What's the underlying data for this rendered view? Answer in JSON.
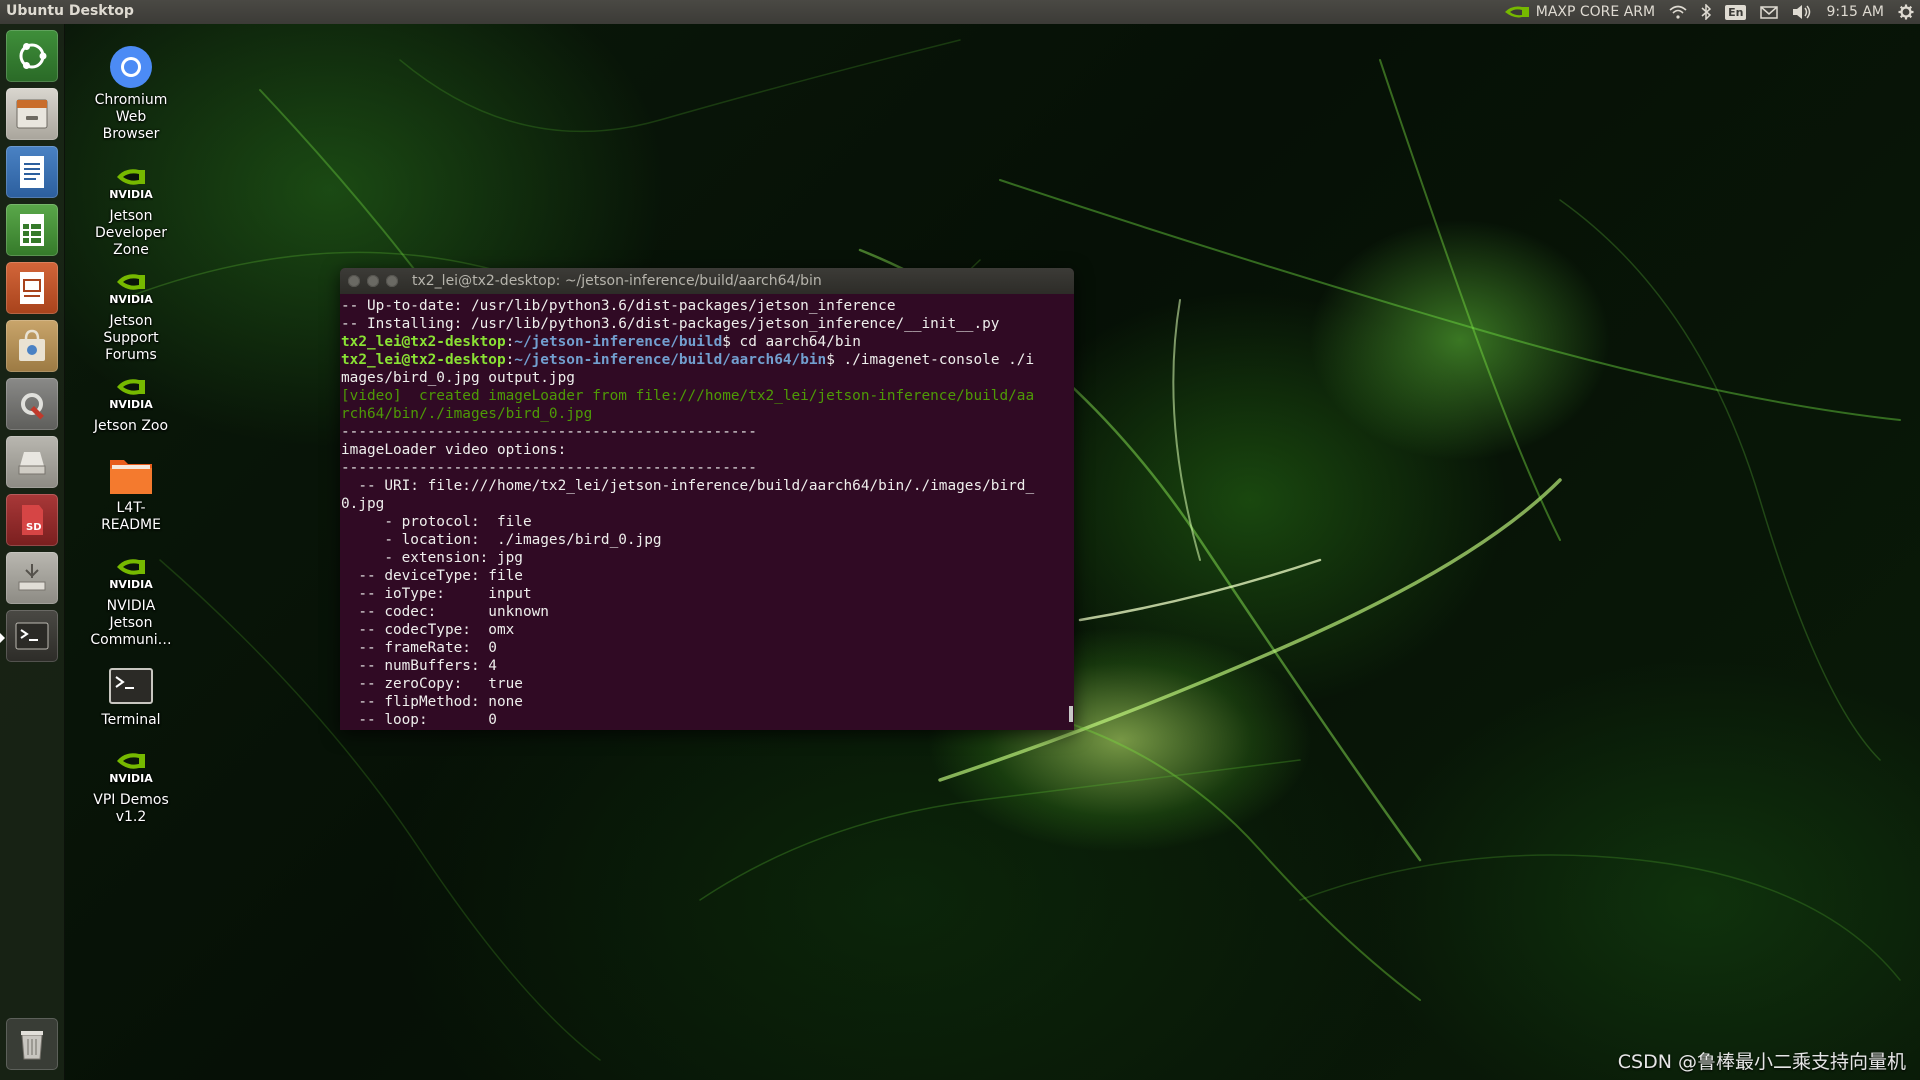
{
  "panel": {
    "title": "Ubuntu Desktop",
    "nvpmodel": "MAXP CORE ARM",
    "keyboard_layout": "En",
    "clock": "9:15 AM",
    "icons": [
      "nvidia-icon",
      "wifi-icon",
      "bluetooth-icon",
      "mail-icon",
      "volume-icon",
      "gear-icon"
    ]
  },
  "launcher": {
    "items": [
      {
        "name": "ubuntu-dash",
        "icon": "ubuntu-logo-icon"
      },
      {
        "name": "files",
        "icon": "file-cabinet-icon"
      },
      {
        "name": "libreoffice-writer",
        "icon": "writer-icon"
      },
      {
        "name": "libreoffice-calc",
        "icon": "calc-icon"
      },
      {
        "name": "libreoffice-impress",
        "icon": "impress-icon"
      },
      {
        "name": "software-center",
        "icon": "shopping-bag-icon"
      },
      {
        "name": "system-settings",
        "icon": "settings-wrench-icon"
      },
      {
        "name": "disk-drive",
        "icon": "drive-icon"
      },
      {
        "name": "sd-card",
        "icon": "sd-card-icon"
      },
      {
        "name": "usb-device",
        "icon": "usb-icon"
      },
      {
        "name": "terminal",
        "icon": "terminal-icon"
      },
      {
        "name": "trash",
        "icon": "trash-icon"
      }
    ]
  },
  "desktop_icons": [
    {
      "label": "Chromium\nWeb\nBrowser",
      "icon": "chromium-icon"
    },
    {
      "label": "Jetson\nDeveloper\nZone",
      "icon": "nvidia-icon"
    },
    {
      "label": "Jetson\nSupport\nForums",
      "icon": "nvidia-icon"
    },
    {
      "label": "Jetson Zoo",
      "icon": "nvidia-icon"
    },
    {
      "label": "L4T-\nREADME",
      "icon": "folder-icon"
    },
    {
      "label": "NVIDIA\nJetson\nCommuni…",
      "icon": "nvidia-icon"
    },
    {
      "label": "Terminal",
      "icon": "terminal-icon"
    },
    {
      "label": "VPI Demos\nv1.2",
      "icon": "nvidia-icon"
    }
  ],
  "terminal": {
    "title": "tx2_lei@tx2-desktop: ~/jetson-inference/build/aarch64/bin",
    "lines": [
      [
        {
          "t": "text",
          "v": "-- Up-to-date: /usr/lib/python3.6/dist-packages/jetson_inference"
        }
      ],
      [
        {
          "t": "text",
          "v": "-- Installing: /usr/lib/python3.6/dist-packages/jetson_inference/__init__.py"
        }
      ],
      [
        {
          "t": "prompt",
          "v": "tx2_lei@tx2-desktop"
        },
        {
          "t": "cmd",
          "v": ":"
        },
        {
          "t": "path",
          "v": "~/jetson-inference/build"
        },
        {
          "t": "cmd",
          "v": "$ cd aarch64/bin"
        }
      ],
      [
        {
          "t": "prompt",
          "v": "tx2_lei@tx2-desktop"
        },
        {
          "t": "cmd",
          "v": ":"
        },
        {
          "t": "path",
          "v": "~/jetson-inference/build/aarch64/bin"
        },
        {
          "t": "cmd",
          "v": "$ ./imagenet-console ./i"
        }
      ],
      [
        {
          "t": "text",
          "v": "mages/bird_0.jpg output.jpg"
        }
      ],
      [
        {
          "t": "log",
          "v": "[video]  created imageLoader from file:///home/tx2_lei/jetson-inference/build/aa"
        }
      ],
      [
        {
          "t": "log",
          "v": "rch64/bin/./images/bird_0.jpg"
        }
      ],
      [
        {
          "t": "text",
          "v": "------------------------------------------------"
        }
      ],
      [
        {
          "t": "text",
          "v": "imageLoader video options:"
        }
      ],
      [
        {
          "t": "text",
          "v": "------------------------------------------------"
        }
      ],
      [
        {
          "t": "text",
          "v": "  -- URI: file:///home/tx2_lei/jetson-inference/build/aarch64/bin/./images/bird_"
        }
      ],
      [
        {
          "t": "text",
          "v": "0.jpg"
        }
      ],
      [
        {
          "t": "text",
          "v": "     - protocol:  file"
        }
      ],
      [
        {
          "t": "text",
          "v": "     - location:  ./images/bird_0.jpg"
        }
      ],
      [
        {
          "t": "text",
          "v": "     - extension: jpg"
        }
      ],
      [
        {
          "t": "text",
          "v": "  -- deviceType: file"
        }
      ],
      [
        {
          "t": "text",
          "v": "  -- ioType:     input"
        }
      ],
      [
        {
          "t": "text",
          "v": "  -- codec:      unknown"
        }
      ],
      [
        {
          "t": "text",
          "v": "  -- codecType:  omx"
        }
      ],
      [
        {
          "t": "text",
          "v": "  -- frameRate:  0"
        }
      ],
      [
        {
          "t": "text",
          "v": "  -- numBuffers: 4"
        }
      ],
      [
        {
          "t": "text",
          "v": "  -- zeroCopy:   true"
        }
      ],
      [
        {
          "t": "text",
          "v": "  -- flipMethod: none"
        }
      ],
      [
        {
          "t": "text",
          "v": "  -- loop:       0"
        }
      ]
    ]
  },
  "watermark": "CSDN @鲁棒最小二乘支持向量机",
  "colors": {
    "panel_bg": "#3c3b37",
    "terminal_bg": "#300a24",
    "prompt_user": "#8ae234",
    "prompt_path": "#729fcf",
    "log_text": "#4e9a06",
    "nvidia_green": "#76b900"
  }
}
